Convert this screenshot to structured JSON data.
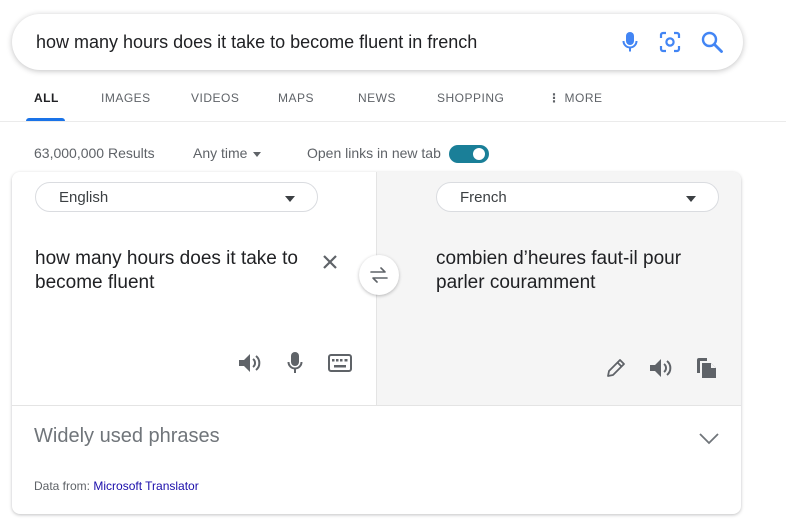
{
  "search": {
    "query": "how many hours does it take to become fluent in french",
    "icons": [
      "mic-icon",
      "lens-icon",
      "search-icon"
    ],
    "colors": {
      "mic": "#4285f4",
      "lens": "#4285f4",
      "search": "#4285f4"
    }
  },
  "tabs": [
    {
      "label": "ALL",
      "active": true
    },
    {
      "label": "IMAGES"
    },
    {
      "label": "VIDEOS"
    },
    {
      "label": "MAPS"
    },
    {
      "label": "NEWS"
    },
    {
      "label": "SHOPPING"
    },
    {
      "label": "MORE"
    }
  ],
  "results": {
    "count": "63,000,000 Results",
    "time_filter": "Any time",
    "open_links_label": "Open links in new tab",
    "open_links_enabled": true
  },
  "translator": {
    "source_language": "English",
    "target_language": "French",
    "source_text": "how many hours does it take to become fluent",
    "target_text": "combien d’heures faut-il pour parler couramment",
    "source_icons": [
      "speaker-icon",
      "mic-icon",
      "keyboard-icon"
    ],
    "target_icons": [
      "pencil-icon",
      "speaker-icon",
      "copy-icon"
    ],
    "phrases_label": "Widely used phrases",
    "data_from_prefix": "Data from:",
    "data_from_link": "Microsoft Translator"
  },
  "colors": {
    "accent": "#1a73e8",
    "toggle": "#1a7f98",
    "link": "#1a0dab"
  }
}
